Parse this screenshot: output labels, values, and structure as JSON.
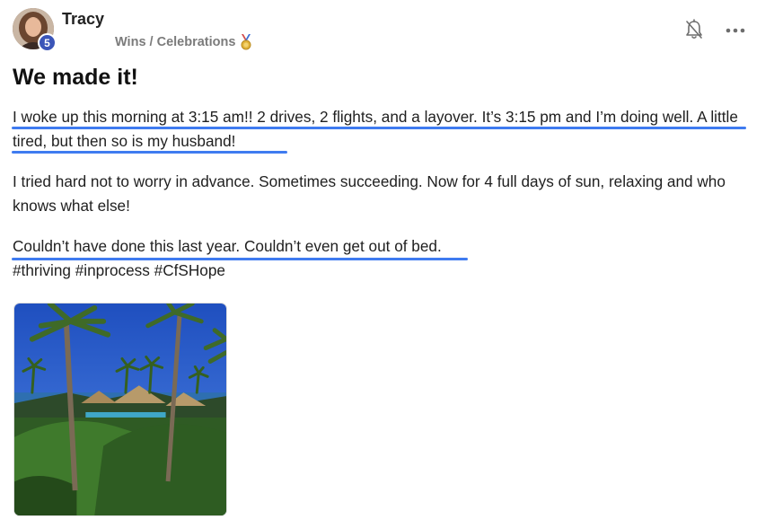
{
  "post": {
    "author": {
      "name": "Tracy",
      "level": "5"
    },
    "category": "Wins / Celebrations",
    "title": "We made it!",
    "paragraphs": [
      "I woke up this morning at 3:15 am!! 2 drives, 2 flights, and a layover. It’s 3:15 pm and I’m doing well. A little tired, but then so is my husband!",
      "I tried hard not to worry in advance. Sometimes succeeding. Now for 4 full days of sun, relaxing and who knows what else!",
      "Couldn’t have done this last year. Couldn’t even get out of bed. ",
      "#thriving #inprocess #CfSHope"
    ]
  },
  "icons": {
    "category": "medal-icon",
    "notifications": "bell-off-icon",
    "more": "more-horizontal-icon"
  },
  "colors": {
    "badge": "#3b55b8",
    "highlight_underline": "#3f7bf0",
    "category_text": "#7b7b7b"
  }
}
